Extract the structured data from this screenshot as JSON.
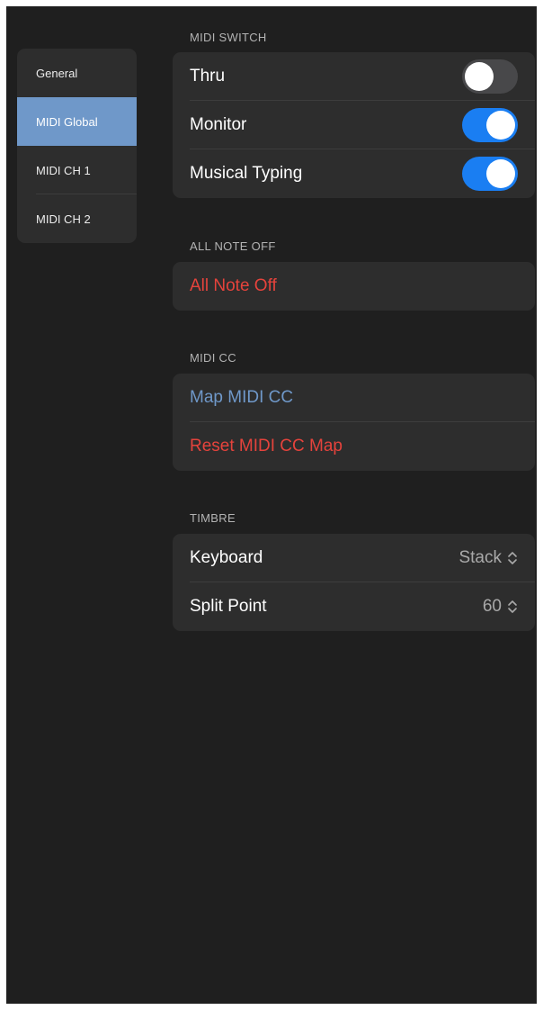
{
  "sidebar": {
    "items": [
      {
        "label": "General",
        "active": false
      },
      {
        "label": "MIDI Global",
        "active": true
      },
      {
        "label": "MIDI CH 1",
        "active": false
      },
      {
        "label": "MIDI CH 2",
        "active": false
      }
    ]
  },
  "midi_switch": {
    "header": "MIDI SWITCH",
    "rows": [
      {
        "label": "Thru",
        "on": false
      },
      {
        "label": "Monitor",
        "on": true
      },
      {
        "label": "Musical Typing",
        "on": true
      }
    ]
  },
  "all_note_off": {
    "header": "ALL NOTE OFF",
    "button_label": "All Note Off"
  },
  "midi_cc": {
    "header": "MIDI CC",
    "map_label": "Map MIDI CC",
    "reset_label": "Reset MIDI CC Map"
  },
  "timbre": {
    "header": "TIMBRE",
    "rows": [
      {
        "label": "Keyboard",
        "value": "Stack"
      },
      {
        "label": "Split Point",
        "value": "60"
      }
    ]
  },
  "colors": {
    "background": "#1f1f1f",
    "card": "#2d2d2d",
    "accent_blue": "#6f98c9",
    "toggle_on": "#1a7ef2",
    "destructive_red": "#e5433c"
  }
}
